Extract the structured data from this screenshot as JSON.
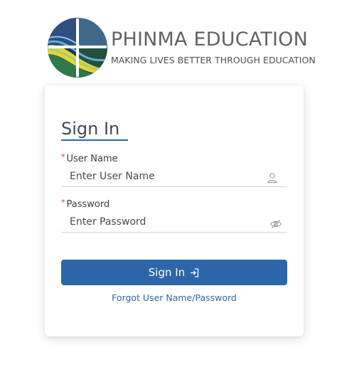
{
  "brand": {
    "name": "PHINMA EDUCATION",
    "tagline": "MAKING LIVES BETTER THROUGH EDUCATION",
    "logo_icon": "phinma-globe-logo"
  },
  "signin_card": {
    "title": "Sign In",
    "username": {
      "label": "User Name",
      "required_marker": "*",
      "placeholder": "Enter User Name",
      "value": "",
      "icon": "user-icon"
    },
    "password": {
      "label": "Password",
      "required_marker": "*",
      "placeholder": "Enter Password",
      "value": "",
      "icon": "eye-slash-icon"
    },
    "submit_label": "Sign In",
    "submit_icon": "login-arrow-icon",
    "forgot_link": "Forgot User Name/Password"
  },
  "colors": {
    "primary": "#2d66a8",
    "required": "#d93025",
    "brand_text": "#5f6368"
  }
}
